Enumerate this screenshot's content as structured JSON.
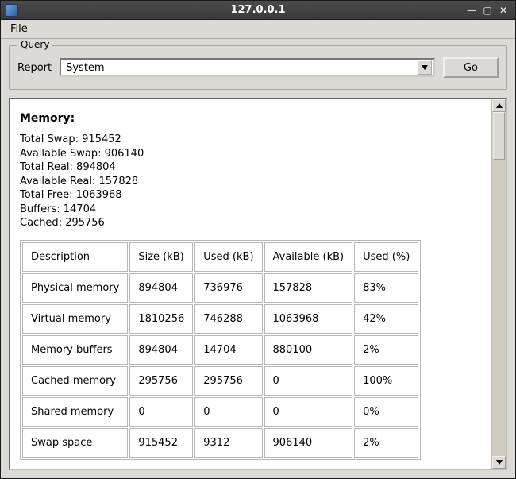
{
  "window": {
    "title": "127.0.0.1"
  },
  "menubar": {
    "file": "File",
    "file_mn": "F"
  },
  "query": {
    "legend": "Query",
    "report_label": "Report",
    "selected": "System",
    "go_label": "Go"
  },
  "memory": {
    "heading": "Memory:",
    "stats": {
      "total_swap_label": "Total Swap",
      "total_swap": "915452",
      "available_swap_label": "Available Swap",
      "available_swap": "906140",
      "total_real_label": "Total Real",
      "total_real": "894804",
      "available_real_label": "Available Real",
      "available_real": "157828",
      "total_free_label": "Total Free",
      "total_free": "1063968",
      "buffers_label": "Buffers",
      "buffers": "14704",
      "cached_label": "Cached",
      "cached": "295756"
    },
    "columns": {
      "description": "Description",
      "size": "Size (kB)",
      "used": "Used (kB)",
      "available": "Available (kB)",
      "used_pct": "Used (%)"
    },
    "rows": [
      {
        "description": "Physical memory",
        "size": "894804",
        "used": "736976",
        "available": "157828",
        "used_pct": "83%"
      },
      {
        "description": "Virtual memory",
        "size": "1810256",
        "used": "746288",
        "available": "1063968",
        "used_pct": "42%"
      },
      {
        "description": "Memory buffers",
        "size": "894804",
        "used": "14704",
        "available": "880100",
        "used_pct": "2%"
      },
      {
        "description": "Cached memory",
        "size": "295756",
        "used": "295756",
        "available": "0",
        "used_pct": "100%"
      },
      {
        "description": "Shared memory",
        "size": "0",
        "used": "0",
        "available": "0",
        "used_pct": "0%"
      },
      {
        "description": "Swap space",
        "size": "915452",
        "used": "9312",
        "available": "906140",
        "used_pct": "2%"
      }
    ]
  }
}
